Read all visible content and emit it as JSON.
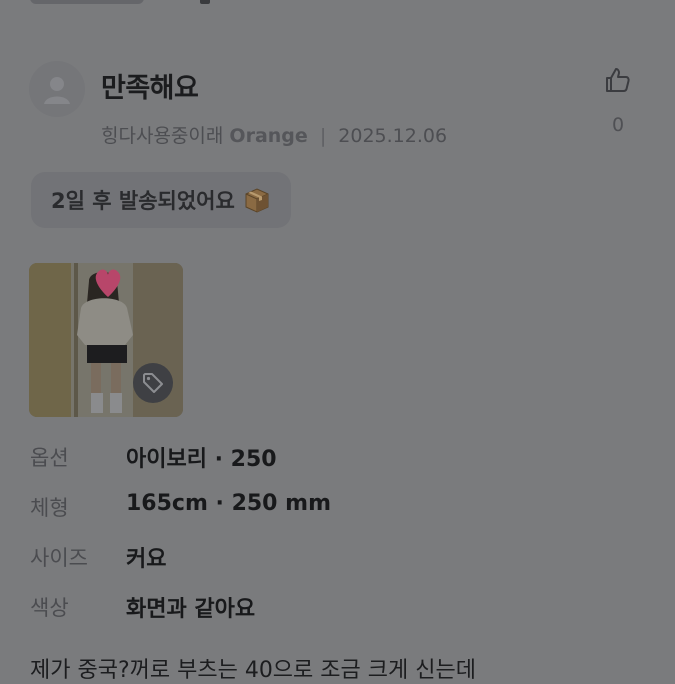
{
  "review": {
    "title": "만족해요",
    "author": "힝다사용중이래",
    "brand": "Orange",
    "separator": "|",
    "date": "2025.12.06",
    "like_count": "0",
    "shipping_badge": "2일 후 발송되었어요",
    "shipping_icon": "package-icon",
    "photo_icon": "price-tag-icon",
    "options": [
      {
        "label": "옵션",
        "value": "아이보리 · 250"
      },
      {
        "label": "체형",
        "value": "165cm · 250 mm"
      },
      {
        "label": "사이즈",
        "value": "커요"
      },
      {
        "label": "색상",
        "value": "화면과 같아요"
      }
    ],
    "body": "제가 중국?꺼로 부츠는 40으로 조금 크게 신는데"
  },
  "colors": {
    "overlay": "#7a7b7d",
    "text_primary": "#1b1c1e",
    "text_secondary": "#4d4e52"
  }
}
